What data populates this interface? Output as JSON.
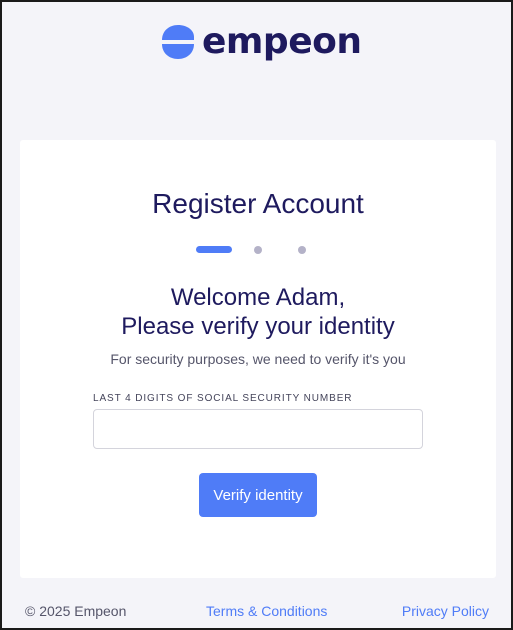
{
  "brand": {
    "name": "empeon",
    "logo_icon": "empeon-logo-icon",
    "color": "#1e1a5e",
    "accent": "#4f7cf7"
  },
  "card": {
    "title": "Register Account",
    "steps": {
      "total": 3,
      "current": 1
    },
    "welcome_line1": "Welcome Adam,",
    "welcome_line2": "Please verify your identity",
    "subtitle": "For security purposes, we need to verify it's you",
    "field": {
      "label": "LAST 4 DIGITS OF SOCIAL SECURITY NUMBER",
      "value": "",
      "placeholder": ""
    },
    "verify_label": "Verify identity"
  },
  "footer": {
    "copyright": "© 2025 Empeon",
    "terms": "Terms & Conditions",
    "privacy": "Privacy Policy"
  }
}
